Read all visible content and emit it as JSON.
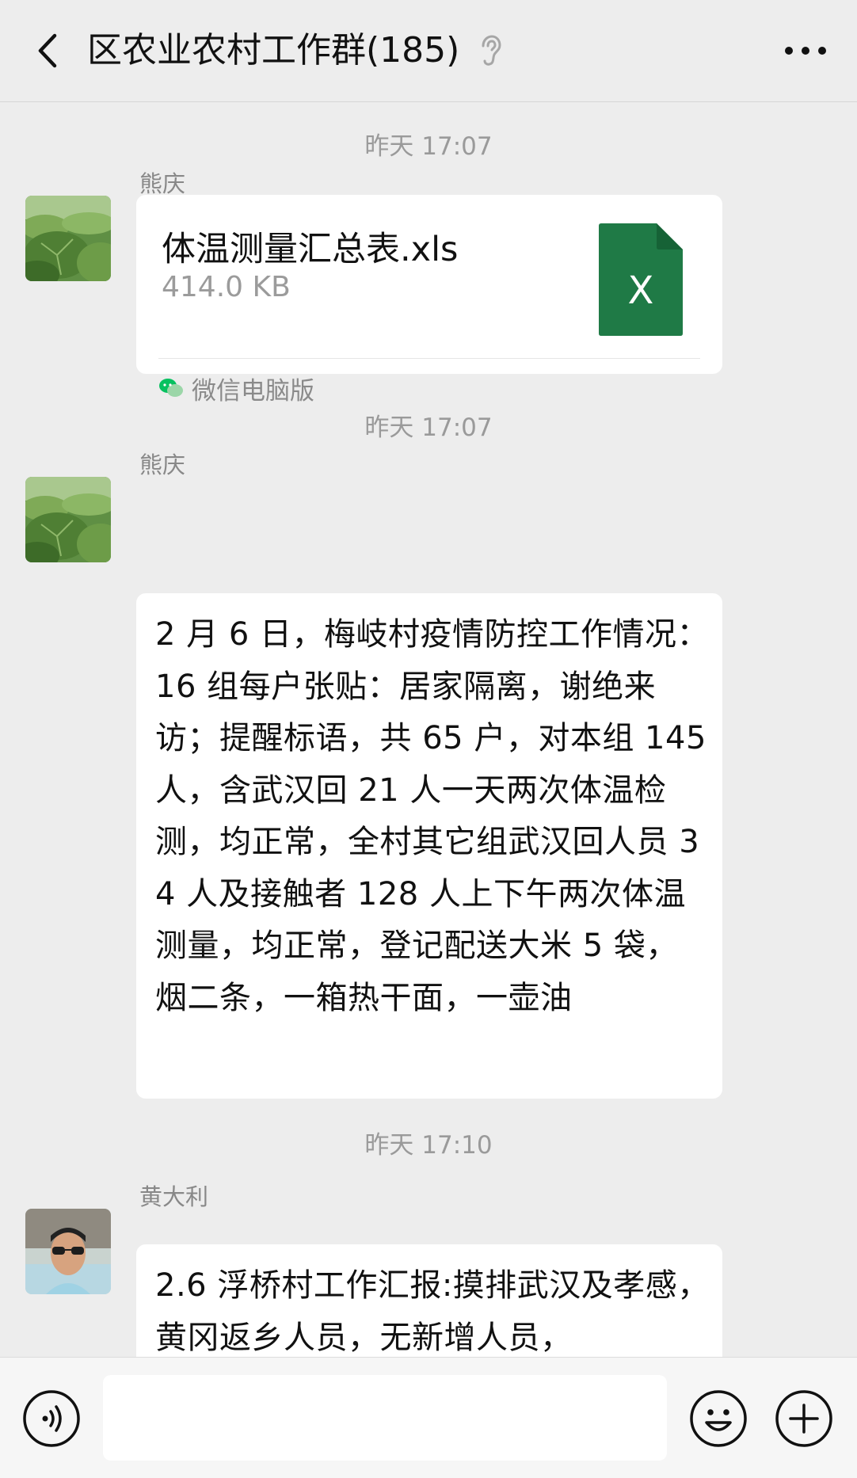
{
  "header": {
    "title": "区农业农村工作群(185)",
    "back_icon": "chevron-left-icon",
    "mute_icon": "ear-mute-icon",
    "more_icon": "more-dots-icon"
  },
  "messages": [
    {
      "timestamp": "昨天 17:07",
      "sender": "熊庆",
      "type": "file",
      "file_name": "体温测量汇总表.xls",
      "file_size": "414.0 KB",
      "file_icon_letter": "X",
      "source": "微信电脑版"
    },
    {
      "timestamp": "昨天 17:07",
      "sender": "熊庆",
      "type": "text",
      "text": "2 月 6 日，梅岐村疫情防控工作情况：16 组每户张贴：居家隔离，谢绝来访；提醒标语，共 65 户，对本组 145 人，含武汉回 21 人一天两次体温检测，均正常，全村其它组武汉回人员 34 人及接触者 128 人上下午两次体温测量，均正常，登记配送大米 5 袋，烟二条，一箱热干面，一壶油"
    },
    {
      "timestamp": "昨天 17:10",
      "sender": "黄大利",
      "type": "text",
      "text": "2.6 浮桥村工作汇报:摸排武汉及孝感，黄冈返乡人员，无新增人员，"
    }
  ],
  "input": {
    "value": "",
    "voice_icon": "voice-icon",
    "emoji_icon": "emoji-icon",
    "plus_icon": "plus-icon"
  },
  "colors": {
    "background": "#ededed",
    "bubble": "#ffffff",
    "excel_green": "#1f7a46",
    "wechat_green": "#07c160"
  }
}
